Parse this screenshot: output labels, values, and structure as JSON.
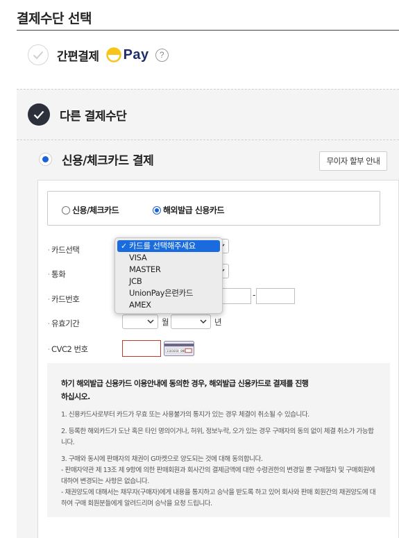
{
  "page": {
    "title": "결제수단 선택"
  },
  "easy_pay": {
    "label": "간편결제",
    "logo_text": "Pay",
    "help_icon": "?"
  },
  "other_methods": {
    "label": "다른 결제수단"
  },
  "card_payment": {
    "label": "신용/체크카드 결제",
    "installment_button": "무이자 할부 안내",
    "card_types": [
      {
        "label": "신용/체크카드",
        "selected": false
      },
      {
        "label": "해외발급 신용카드",
        "selected": true
      }
    ]
  },
  "form": {
    "card_select_label": "카드선택",
    "currency_label": "통화",
    "card_number_label": "카드번호",
    "card_number_separator": "-",
    "expiry_label": "유효기간",
    "expiry_month_unit": "월",
    "expiry_year_unit": "년",
    "cvc_label": "CVC2 번호",
    "card_image_text": "1101010 000",
    "bullet": "·"
  },
  "dropdown": {
    "options": [
      {
        "label": "카드를 선택해주세요",
        "selected": true
      },
      {
        "label": "VISA",
        "selected": false
      },
      {
        "label": "MASTER",
        "selected": false
      },
      {
        "label": "JCB",
        "selected": false
      },
      {
        "label": "UnionPay은련카드",
        "selected": false
      },
      {
        "label": "AMEX",
        "selected": false
      }
    ],
    "check_mark": "✓"
  },
  "notice": {
    "title": "하기 해외발급 신용카드 이용안내에 동의한 경우, 해외발급 신용카드로 결제를 진행하십시오.",
    "p1": "1. 신용카드사로부터 카드가 무효 또는 사용불가의 통지가 있는 경우 체결이 취소될 수 있습니다.",
    "p2": "2. 등록한 해외카드가 도난 혹은 타인 명의이거나, 허위, 정보누락, 오가 있는 경우 구매자의 동의 없이 체결 취소가 가능합니다.",
    "p3": "3. 구매와 동시에 판매자의 채권이 G마켓으로 양도되는 것에 대해 동의합니다.",
    "p3a": "- 판매자약관 제 13조 제 9항에 의한 판매회원과 회사간의 결제금액에 대한 수령권한의 변경일 뿐 구매절차 및 구매회원에 대하여 변경되는 사항은 없습니다.",
    "p3b": "- 채권양도에 대해서는 채무자(구매자)에게 내용을 통지하고 승낙을 받도록 하고 있어 회사와 판매 회원간의 채권양도에 대하여 구매 회원분들에게 알려드리며 승낙을 요청 드립니다."
  },
  "colors": {
    "accent_blue": "#1a62d6",
    "logo_yellow": "#f5c518",
    "logo_navy": "#1e2e6b",
    "dark_check": "#2b303b",
    "error_border": "#c0392b"
  }
}
